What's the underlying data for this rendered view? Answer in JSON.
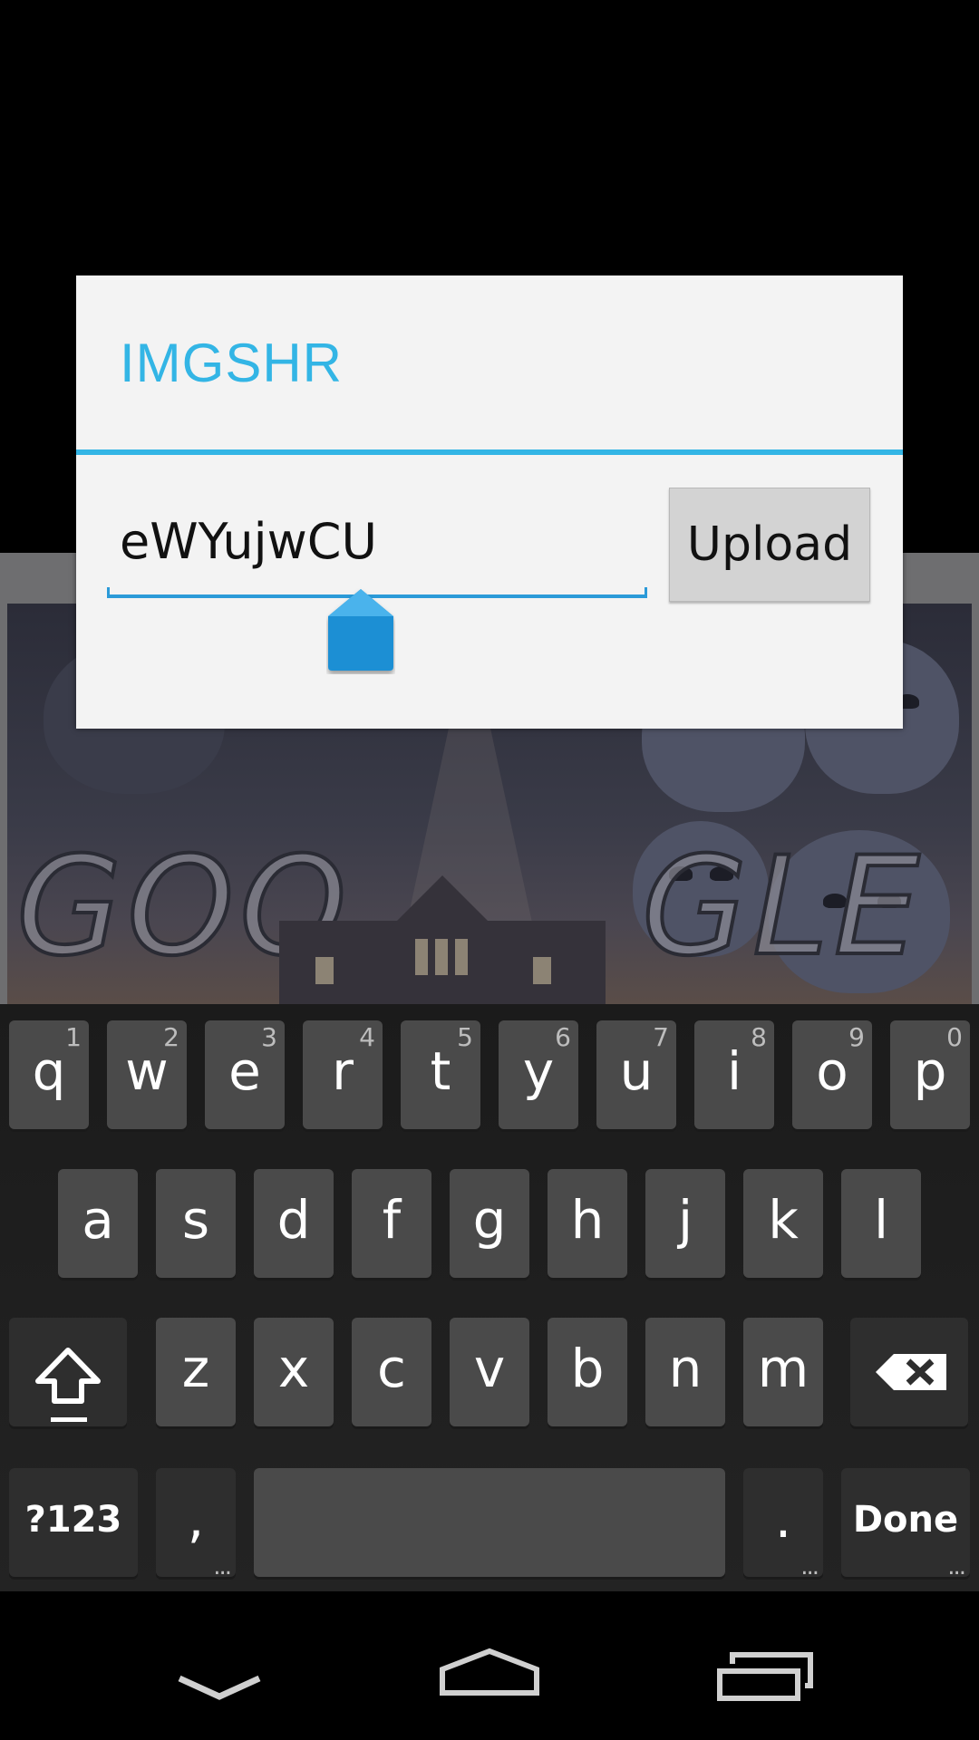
{
  "dialog": {
    "title": "IMGSHR",
    "input_value": "eWYujwCU",
    "upload_label": "Upload"
  },
  "background": {
    "doodle_left": "GOO",
    "doodle_right": "GLE"
  },
  "keyboard": {
    "row1": [
      {
        "key": "q",
        "hint": "1"
      },
      {
        "key": "w",
        "hint": "2"
      },
      {
        "key": "e",
        "hint": "3"
      },
      {
        "key": "r",
        "hint": "4"
      },
      {
        "key": "t",
        "hint": "5"
      },
      {
        "key": "y",
        "hint": "6"
      },
      {
        "key": "u",
        "hint": "7"
      },
      {
        "key": "i",
        "hint": "8"
      },
      {
        "key": "o",
        "hint": "9"
      },
      {
        "key": "p",
        "hint": "0"
      }
    ],
    "row2": [
      "a",
      "s",
      "d",
      "f",
      "g",
      "h",
      "j",
      "k",
      "l"
    ],
    "row3": [
      "z",
      "x",
      "c",
      "v",
      "b",
      "n",
      "m"
    ],
    "symbols_label": "?123",
    "comma_label": ",",
    "period_label": ".",
    "done_label": "Done",
    "shift_icon": "shift-icon",
    "backspace_icon": "backspace-icon"
  },
  "nav": {
    "back_icon": "back-chevron-icon",
    "home_icon": "home-icon",
    "recents_icon": "recents-icon"
  },
  "colors": {
    "accent": "#33b5e5",
    "underline": "#2b9ad8",
    "key_bg": "#4a4a4a",
    "dialog_bg": "#f3f3f3"
  }
}
